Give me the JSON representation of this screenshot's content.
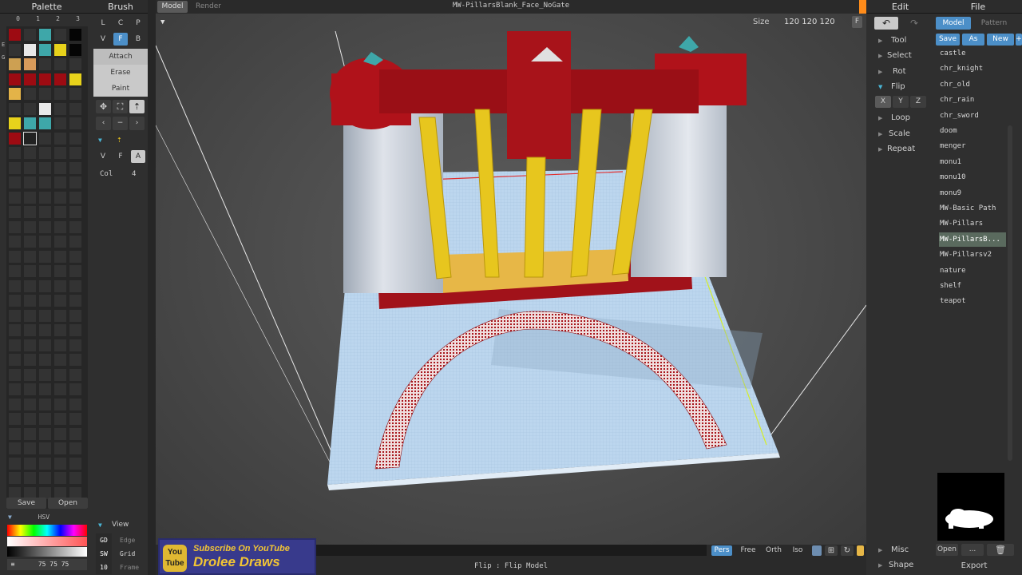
{
  "palette": {
    "title": "Palette",
    "columns": [
      "0",
      "1",
      "2",
      "3"
    ],
    "side_labels": [
      "E",
      "G"
    ],
    "save": "Save",
    "open": "Open"
  },
  "colors": {
    "red": "#9d0b12",
    "yellow": "#e7d21b",
    "teal": "#3ea7a9",
    "white": "#e8e8e8",
    "accent": "#4c8fc8",
    "selected_list": "#5a6a5e",
    "orange": "#ff8c1a"
  },
  "brush": {
    "title": "Brush",
    "row1": [
      "L",
      "C",
      "P"
    ],
    "row2": [
      "V",
      "F",
      "B"
    ],
    "modes": [
      "Attach",
      "Erase",
      "Paint"
    ],
    "row3": [
      "V",
      "F",
      "A"
    ],
    "col_label": "Col",
    "col_value": "4"
  },
  "color_picker": {
    "mode": "HSV",
    "value": "75 75 75"
  },
  "view": {
    "title": "View",
    "rows": [
      {
        "key": "GD",
        "label": "Edge"
      },
      {
        "key": "SW",
        "label": "Grid"
      },
      {
        "key": "10",
        "label": "Frame"
      }
    ]
  },
  "viewport": {
    "tabs": [
      "Model",
      "Render"
    ],
    "title": "MW-PillarsBlank_Face_NoGate",
    "size_label": "Size",
    "size_value": "120 120 120",
    "size_button": "F"
  },
  "bottombar": {
    "views": [
      "Pers",
      "Free",
      "Orth",
      "Iso"
    ],
    "status": "Flip : Flip Model"
  },
  "overlay": {
    "subscribe": "Subscribe On YouTube",
    "channel": "Drolee Draws",
    "yt_top": "You",
    "yt_bottom": "Tube"
  },
  "edit": {
    "title": "Edit",
    "tree": [
      "Tool",
      "Select",
      "Rot",
      "Flip",
      "Loop",
      "Scale",
      "Repeat"
    ],
    "flip_axes": [
      "X",
      "Y",
      "Z"
    ],
    "bottom": [
      "Misc",
      "Shape"
    ]
  },
  "file": {
    "title": "File",
    "tabs": [
      "Model",
      "Pattern"
    ],
    "actions": [
      "Save",
      "As",
      "New"
    ],
    "plus": "+",
    "models": [
      "castle",
      "chr_knight",
      "chr_old",
      "chr_rain",
      "chr_sword",
      "doom",
      "menger",
      "monu1",
      "monu10",
      "monu9",
      "MW-Basic Path",
      "MW-Pillars",
      "MW-PillarsB...",
      "MW-Pillarsv2",
      "nature",
      "shelf",
      "teapot"
    ],
    "selected_model": "MW-PillarsB...",
    "open": "Open",
    "more": "...",
    "export": "Export"
  }
}
